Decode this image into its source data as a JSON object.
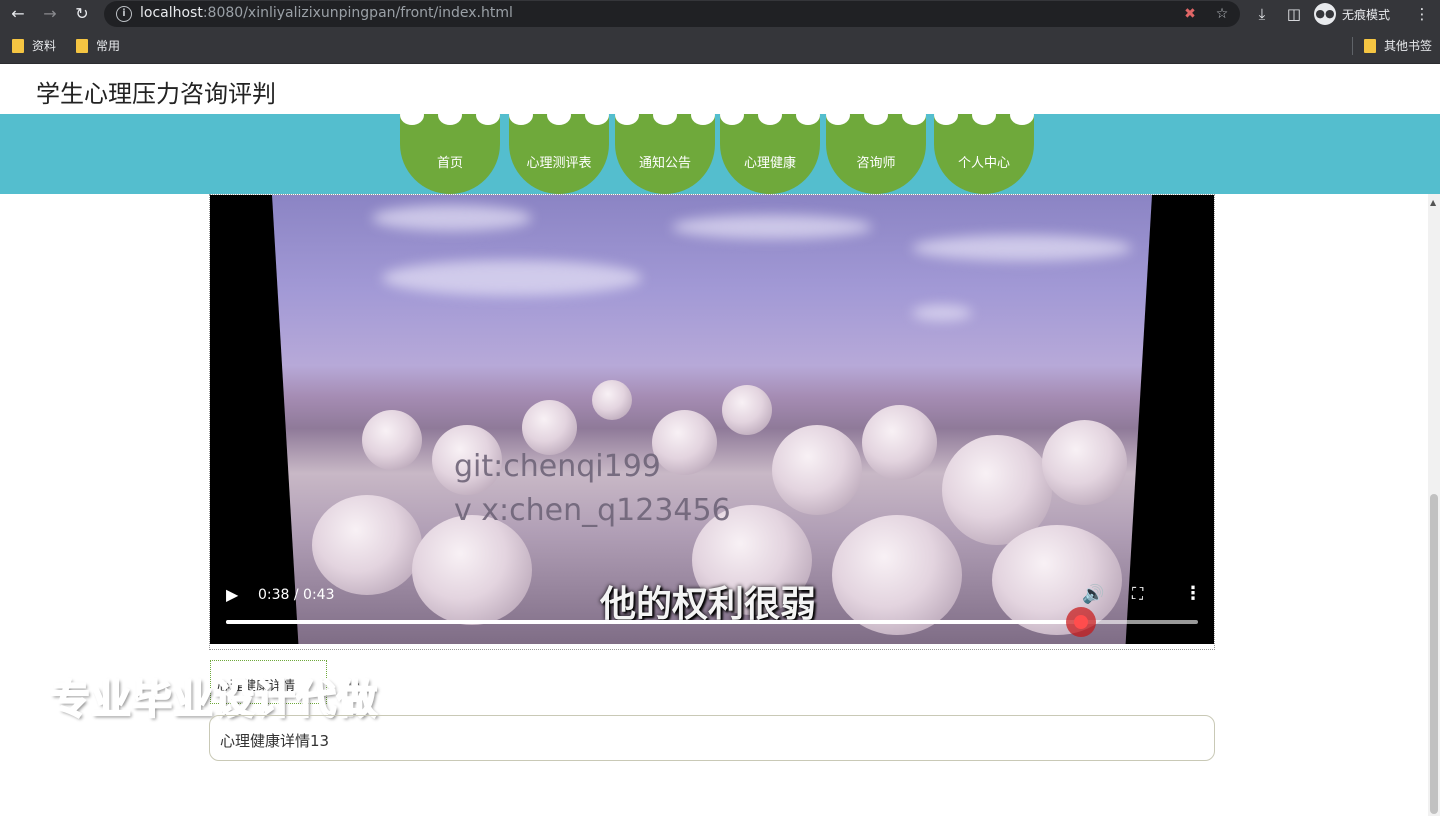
{
  "browser": {
    "url_host": "localhost",
    "url_rest": ":8080/xinliyalizixunpingpan/front/index.html",
    "incognito_label": "无痕模式",
    "bookmarks": [
      "资料",
      "常用"
    ],
    "other_bookmarks": "其他书签"
  },
  "site": {
    "title": "学生心理压力咨询评判",
    "nav": [
      "首页",
      "心理测评表",
      "通知公告",
      "心理健康",
      "咨询师",
      "个人中心"
    ]
  },
  "video": {
    "time": "0:38 / 0:43",
    "progress": 0.88,
    "watermark_line1": "git:chenqi199",
    "watermark_line2": "v x:chen_q123456",
    "subtitle": "他的权利很弱"
  },
  "content": {
    "tab_label": "心理健康详情",
    "tab_more": "...",
    "promo_overlay": "专业毕业设计代做",
    "detail_text": "心理健康详情13"
  },
  "icons": {
    "back": "back-arrow-icon",
    "forward": "forward-arrow-icon",
    "reload": "reload-icon",
    "info": "info-icon",
    "star": "star-icon",
    "download": "download-icon",
    "sidepanel": "side-panel-icon",
    "menu": "kebab-menu-icon",
    "play": "play-icon",
    "volume": "volume-icon",
    "fullscreen": "fullscreen-icon"
  },
  "colors": {
    "nav_bar": "#54bece",
    "nav_item": "#6fa93b",
    "browser_chrome": "#35363a"
  }
}
